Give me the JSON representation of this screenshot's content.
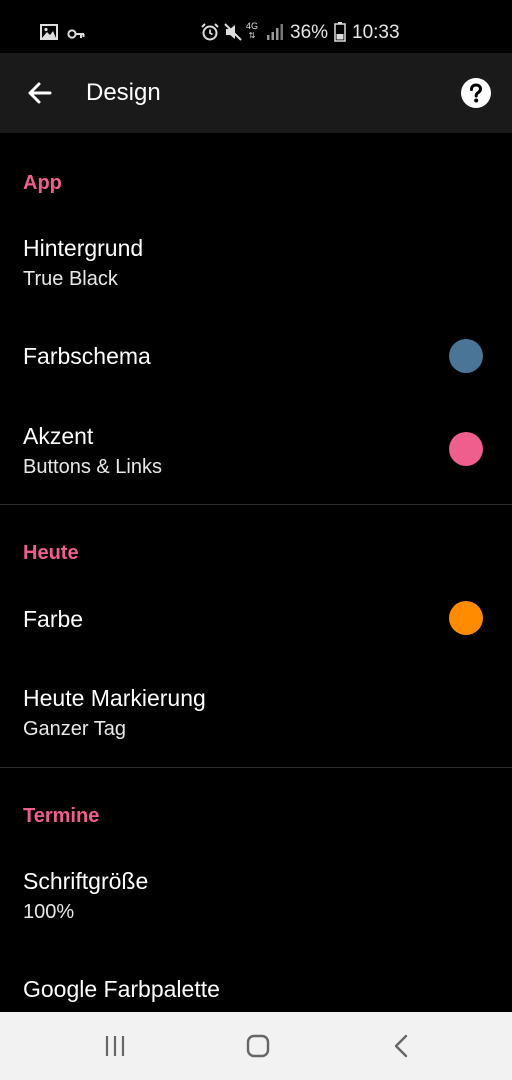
{
  "status_bar": {
    "battery": "36%",
    "time": "10:33",
    "network": "4G",
    "left_icons": [
      "image-icon",
      "key-icon"
    ],
    "right_icons": [
      "alarm-icon",
      "mute-icon",
      "network-4g-icon",
      "signal-icon",
      "battery-icon"
    ]
  },
  "app_bar": {
    "title": "Design"
  },
  "sections": {
    "app": {
      "header": "App",
      "hintergrund": {
        "title": "Hintergrund",
        "subtitle": "True Black"
      },
      "farbschema": {
        "title": "Farbschema",
        "color": "#4a7597"
      },
      "akzent": {
        "title": "Akzent",
        "subtitle": "Buttons & Links",
        "color": "#ee5f8d"
      }
    },
    "heute": {
      "header": "Heute",
      "farbe": {
        "title": "Farbe",
        "color": "#ff8c00"
      },
      "markierung": {
        "title": "Heute Markierung",
        "subtitle": "Ganzer Tag"
      }
    },
    "termine": {
      "header": "Termine",
      "schriftgroesse": {
        "title": "Schriftgröße",
        "subtitle": "100%"
      },
      "farbpalette": {
        "title": "Google Farbpalette"
      }
    }
  },
  "colors": {
    "accent": "#ee5f8d",
    "background": "#000000",
    "app_bar": "#1a1a1a",
    "nav_bar": "#f2f2f2"
  },
  "nav_bar": {
    "icons": [
      "recent-apps-icon",
      "home-icon",
      "back-icon"
    ]
  }
}
